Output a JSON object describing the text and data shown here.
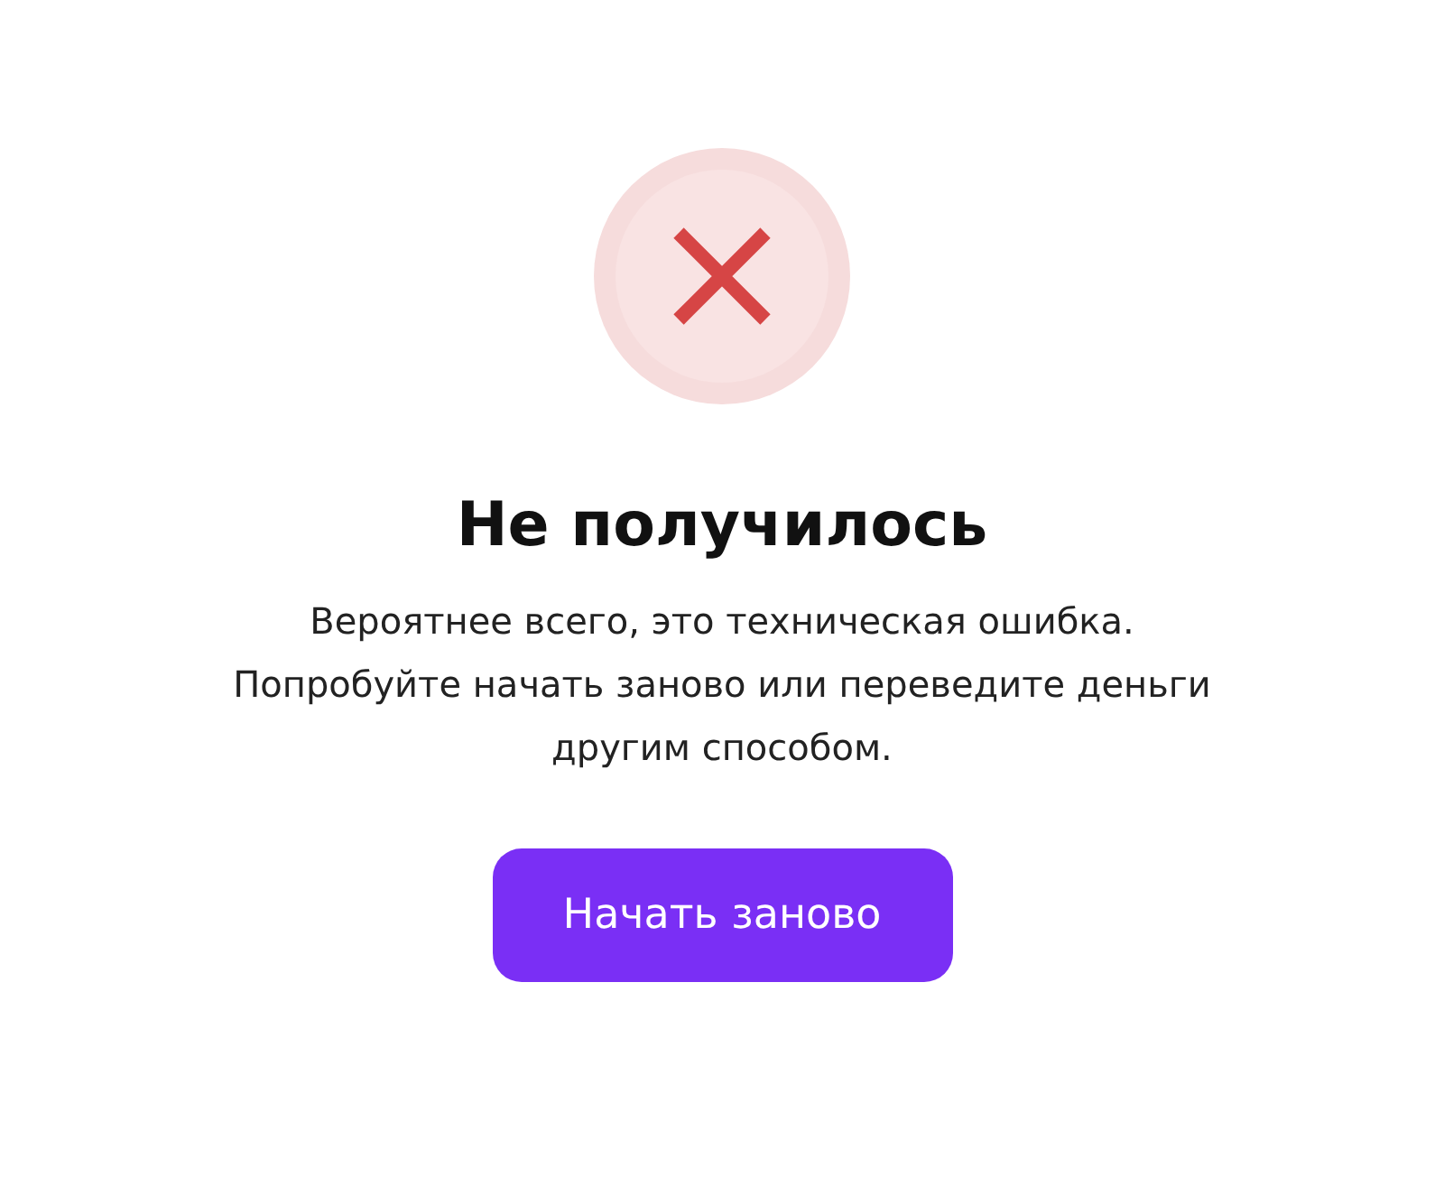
{
  "status": {
    "kind": "error"
  },
  "title": "Не получилось",
  "message_lines": [
    "Вероятнее всего, это техническая ошибка.",
    "Попробуйте начать заново или переведите деньги",
    "другим способом."
  ],
  "button": {
    "label": "Начать заново"
  }
}
